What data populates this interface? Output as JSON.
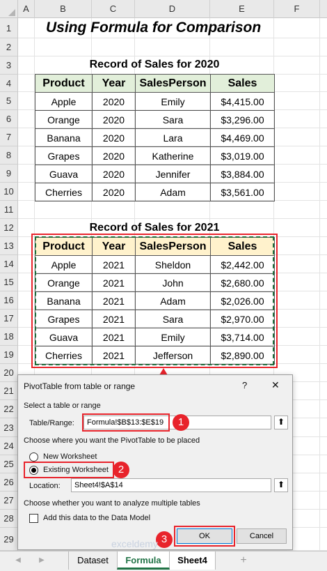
{
  "columns": [
    "A",
    "B",
    "C",
    "D",
    "E",
    "F"
  ],
  "rows": [
    "1",
    "2",
    "3",
    "4",
    "5",
    "6",
    "7",
    "8",
    "9",
    "10",
    "11",
    "12",
    "13",
    "14",
    "15",
    "16",
    "17",
    "18",
    "19",
    "20",
    "21",
    "22",
    "23",
    "24",
    "25",
    "26",
    "27",
    "28",
    "29"
  ],
  "sheet_title": "Using Formula for Comparison",
  "table_2020": {
    "title": "Record of Sales for 2020",
    "headers": [
      "Product",
      "Year",
      "SalesPerson",
      "Sales"
    ],
    "rows": [
      [
        "Apple",
        "2020",
        "Emily",
        "$4,415.00"
      ],
      [
        "Orange",
        "2020",
        "Sara",
        "$3,296.00"
      ],
      [
        "Banana",
        "2020",
        "Lara",
        "$4,469.00"
      ],
      [
        "Grapes",
        "2020",
        "Katherine",
        "$3,019.00"
      ],
      [
        "Guava",
        "2020",
        "Jennifer",
        "$3,884.00"
      ],
      [
        "Cherries",
        "2020",
        "Adam",
        "$3,561.00"
      ]
    ]
  },
  "table_2021": {
    "title": "Record of Sales for 2021",
    "headers": [
      "Product",
      "Year",
      "SalesPerson",
      "Sales"
    ],
    "rows": [
      [
        "Apple",
        "2021",
        "Sheldon",
        "$2,442.00"
      ],
      [
        "Orange",
        "2021",
        "John",
        "$2,680.00"
      ],
      [
        "Banana",
        "2021",
        "Adam",
        "$2,026.00"
      ],
      [
        "Grapes",
        "2021",
        "Sara",
        "$2,970.00"
      ],
      [
        "Guava",
        "2021",
        "Emily",
        "$3,714.00"
      ],
      [
        "Cherries",
        "2021",
        "Jefferson",
        "$2,890.00"
      ]
    ]
  },
  "dialog": {
    "title": "PivotTable from table or range",
    "help": "?",
    "close": "✕",
    "section1": "Select a table or range",
    "table_range_label": "Table/Range:",
    "table_range_value": "Formula!$B$13:$E$19",
    "section2": "Choose where you want the PivotTable to be placed",
    "new_worksheet": "New Worksheet",
    "existing_worksheet": "Existing Worksheet",
    "location_label": "Location:",
    "location_value": "Sheet4!$A$14",
    "section3": "Choose whether you want to analyze multiple tables",
    "data_model": "Add this data to the Data Model",
    "ok": "OK",
    "cancel": "Cancel",
    "range_icon": "⬆"
  },
  "badges": [
    "1",
    "2",
    "3"
  ],
  "tabs": {
    "dataset": "Dataset",
    "formula": "Formula",
    "sheet4": "Sheet4",
    "add": "+",
    "prev": "◀",
    "next": "▶"
  },
  "watermark": "exceldemy",
  "colors": {
    "accent_green": "#1e6b3a",
    "highlight_red": "#e8232b",
    "hdr_2020": "#e2efda",
    "hdr_2021": "#fff2cc"
  }
}
